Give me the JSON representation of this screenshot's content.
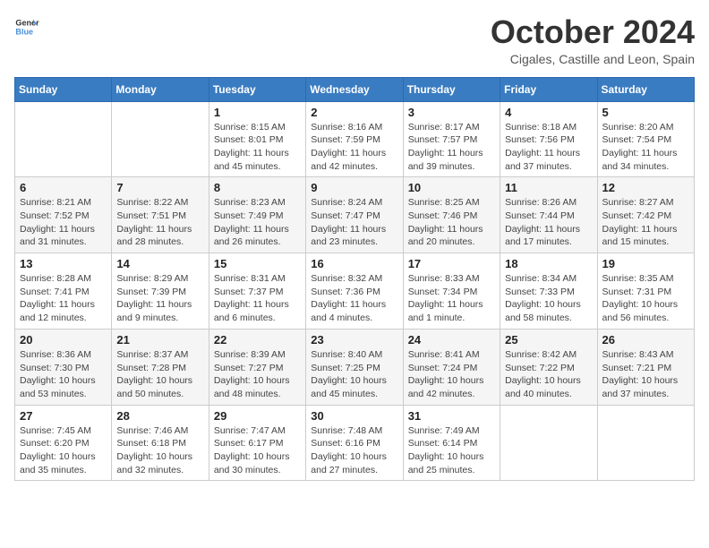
{
  "logo": {
    "line1": "General",
    "line2": "Blue"
  },
  "title": "October 2024",
  "subtitle": "Cigales, Castille and Leon, Spain",
  "days_of_week": [
    "Sunday",
    "Monday",
    "Tuesday",
    "Wednesday",
    "Thursday",
    "Friday",
    "Saturday"
  ],
  "weeks": [
    [
      {
        "day": "",
        "info": ""
      },
      {
        "day": "",
        "info": ""
      },
      {
        "day": "1",
        "info": "Sunrise: 8:15 AM\nSunset: 8:01 PM\nDaylight: 11 hours and 45 minutes."
      },
      {
        "day": "2",
        "info": "Sunrise: 8:16 AM\nSunset: 7:59 PM\nDaylight: 11 hours and 42 minutes."
      },
      {
        "day": "3",
        "info": "Sunrise: 8:17 AM\nSunset: 7:57 PM\nDaylight: 11 hours and 39 minutes."
      },
      {
        "day": "4",
        "info": "Sunrise: 8:18 AM\nSunset: 7:56 PM\nDaylight: 11 hours and 37 minutes."
      },
      {
        "day": "5",
        "info": "Sunrise: 8:20 AM\nSunset: 7:54 PM\nDaylight: 11 hours and 34 minutes."
      }
    ],
    [
      {
        "day": "6",
        "info": "Sunrise: 8:21 AM\nSunset: 7:52 PM\nDaylight: 11 hours and 31 minutes."
      },
      {
        "day": "7",
        "info": "Sunrise: 8:22 AM\nSunset: 7:51 PM\nDaylight: 11 hours and 28 minutes."
      },
      {
        "day": "8",
        "info": "Sunrise: 8:23 AM\nSunset: 7:49 PM\nDaylight: 11 hours and 26 minutes."
      },
      {
        "day": "9",
        "info": "Sunrise: 8:24 AM\nSunset: 7:47 PM\nDaylight: 11 hours and 23 minutes."
      },
      {
        "day": "10",
        "info": "Sunrise: 8:25 AM\nSunset: 7:46 PM\nDaylight: 11 hours and 20 minutes."
      },
      {
        "day": "11",
        "info": "Sunrise: 8:26 AM\nSunset: 7:44 PM\nDaylight: 11 hours and 17 minutes."
      },
      {
        "day": "12",
        "info": "Sunrise: 8:27 AM\nSunset: 7:42 PM\nDaylight: 11 hours and 15 minutes."
      }
    ],
    [
      {
        "day": "13",
        "info": "Sunrise: 8:28 AM\nSunset: 7:41 PM\nDaylight: 11 hours and 12 minutes."
      },
      {
        "day": "14",
        "info": "Sunrise: 8:29 AM\nSunset: 7:39 PM\nDaylight: 11 hours and 9 minutes."
      },
      {
        "day": "15",
        "info": "Sunrise: 8:31 AM\nSunset: 7:37 PM\nDaylight: 11 hours and 6 minutes."
      },
      {
        "day": "16",
        "info": "Sunrise: 8:32 AM\nSunset: 7:36 PM\nDaylight: 11 hours and 4 minutes."
      },
      {
        "day": "17",
        "info": "Sunrise: 8:33 AM\nSunset: 7:34 PM\nDaylight: 11 hours and 1 minute."
      },
      {
        "day": "18",
        "info": "Sunrise: 8:34 AM\nSunset: 7:33 PM\nDaylight: 10 hours and 58 minutes."
      },
      {
        "day": "19",
        "info": "Sunrise: 8:35 AM\nSunset: 7:31 PM\nDaylight: 10 hours and 56 minutes."
      }
    ],
    [
      {
        "day": "20",
        "info": "Sunrise: 8:36 AM\nSunset: 7:30 PM\nDaylight: 10 hours and 53 minutes."
      },
      {
        "day": "21",
        "info": "Sunrise: 8:37 AM\nSunset: 7:28 PM\nDaylight: 10 hours and 50 minutes."
      },
      {
        "day": "22",
        "info": "Sunrise: 8:39 AM\nSunset: 7:27 PM\nDaylight: 10 hours and 48 minutes."
      },
      {
        "day": "23",
        "info": "Sunrise: 8:40 AM\nSunset: 7:25 PM\nDaylight: 10 hours and 45 minutes."
      },
      {
        "day": "24",
        "info": "Sunrise: 8:41 AM\nSunset: 7:24 PM\nDaylight: 10 hours and 42 minutes."
      },
      {
        "day": "25",
        "info": "Sunrise: 8:42 AM\nSunset: 7:22 PM\nDaylight: 10 hours and 40 minutes."
      },
      {
        "day": "26",
        "info": "Sunrise: 8:43 AM\nSunset: 7:21 PM\nDaylight: 10 hours and 37 minutes."
      }
    ],
    [
      {
        "day": "27",
        "info": "Sunrise: 7:45 AM\nSunset: 6:20 PM\nDaylight: 10 hours and 35 minutes."
      },
      {
        "day": "28",
        "info": "Sunrise: 7:46 AM\nSunset: 6:18 PM\nDaylight: 10 hours and 32 minutes."
      },
      {
        "day": "29",
        "info": "Sunrise: 7:47 AM\nSunset: 6:17 PM\nDaylight: 10 hours and 30 minutes."
      },
      {
        "day": "30",
        "info": "Sunrise: 7:48 AM\nSunset: 6:16 PM\nDaylight: 10 hours and 27 minutes."
      },
      {
        "day": "31",
        "info": "Sunrise: 7:49 AM\nSunset: 6:14 PM\nDaylight: 10 hours and 25 minutes."
      },
      {
        "day": "",
        "info": ""
      },
      {
        "day": "",
        "info": ""
      }
    ]
  ]
}
